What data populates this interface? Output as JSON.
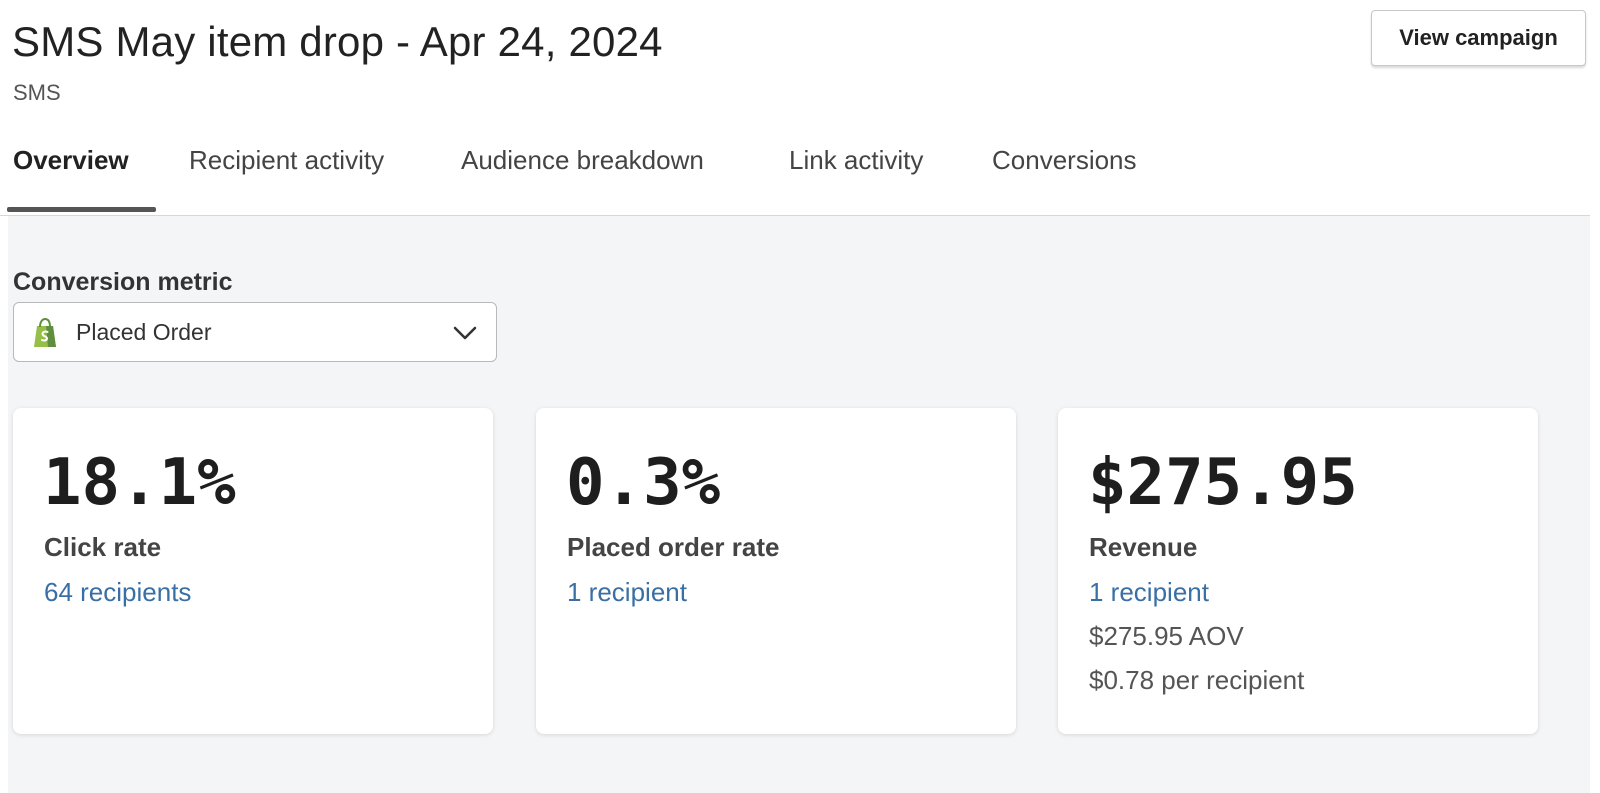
{
  "header": {
    "title": "SMS May item drop - Apr 24, 2024",
    "subtitle": "SMS",
    "view_campaign_label": "View campaign"
  },
  "tabs": [
    {
      "label": "Overview",
      "active": true
    },
    {
      "label": "Recipient activity",
      "active": false
    },
    {
      "label": "Audience breakdown",
      "active": false
    },
    {
      "label": "Link activity",
      "active": false
    },
    {
      "label": "Conversions",
      "active": false
    }
  ],
  "conversion_metric": {
    "label": "Conversion metric",
    "selected": "Placed Order",
    "icon": "shopify-bag-icon",
    "icon_color": "#95bf47"
  },
  "cards": [
    {
      "value": "18.1%",
      "label": "Click rate",
      "link": "64 recipients"
    },
    {
      "value": "0.3%",
      "label": "Placed order rate",
      "link": "1 recipient"
    },
    {
      "value": "$275.95",
      "label": "Revenue",
      "link": "1 recipient",
      "aov": "$275.95 AOV",
      "per_recipient": "$0.78 per recipient"
    }
  ],
  "colors": {
    "link": "#3a6fa5",
    "content_background": "#f4f5f7",
    "tab_underline": "#555555"
  }
}
